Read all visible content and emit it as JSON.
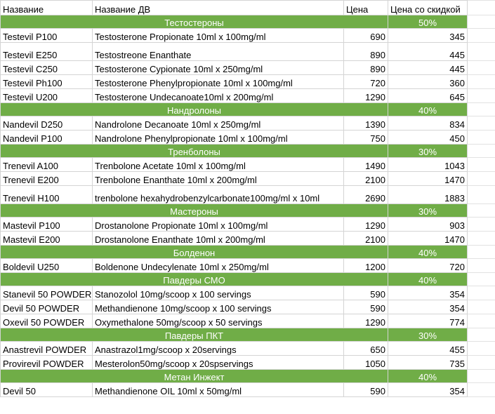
{
  "header": {
    "name": "Название",
    "substance": "Название ДВ",
    "price": "Цена",
    "discount_price": "Цена со скидкой"
  },
  "sections": [
    {
      "title": "Тестостероны",
      "discount": "50%",
      "items": [
        {
          "name": "Testevil P100",
          "substance": "Testosterone Propionate 10ml x 100mg/ml",
          "price": "690",
          "discount_price": "345"
        },
        {
          "name": "Testevil E250",
          "substance": "Testostreone Enanthate",
          "price": "890",
          "discount_price": "445"
        },
        {
          "name": "Testevil C250",
          "substance": "Testosterone Cypionate 10ml x 250mg/ml",
          "price": "890",
          "discount_price": "445"
        },
        {
          "name": "Testevil Ph100",
          "substance": "Testosterone Phenylpropionate 10ml x 100mg/ml",
          "price": "720",
          "discount_price": "360"
        },
        {
          "name": "Testevil U200",
          "substance": "Testosterone Undecanoate10ml x 200mg/ml",
          "price": "1290",
          "discount_price": "645"
        }
      ]
    },
    {
      "title": "Нандролоны",
      "discount": "40%",
      "items": [
        {
          "name": "Nandevil D250",
          "substance": "Nandrolone Decanoate 10ml x 250mg/ml",
          "price": "1390",
          "discount_price": "834"
        },
        {
          "name": "Nandevil P100",
          "substance": "Nandrolone Phenylpropionate 10ml x 100mg/ml",
          "price": "750",
          "discount_price": "450"
        }
      ]
    },
    {
      "title": "Тренболоны",
      "discount": "30%",
      "items": [
        {
          "name": "Trenevil A100",
          "substance": "Trenbolone Acetate 10ml x 100mg/ml",
          "price": "1490",
          "discount_price": "1043"
        },
        {
          "name": "Trenevil E200",
          "substance": "Trenbolone Enanthate 10ml x 200mg/ml",
          "price": "2100",
          "discount_price": "1470"
        },
        {
          "name": "Trenevil H100",
          "substance": "trenbolone hexahydrobenzylcarbonate100mg/ml x 10ml",
          "price": "2690",
          "discount_price": "1883"
        }
      ]
    },
    {
      "title": "Мастероны",
      "discount": "30%",
      "items": [
        {
          "name": "Mastevil P100",
          "substance": "Drostanolone Propionate 10ml x 100mg/ml",
          "price": "1290",
          "discount_price": "903"
        },
        {
          "name": "Mastevil E200",
          "substance": "Drostanolone Enanthate 10ml x 200mg/ml",
          "price": "2100",
          "discount_price": "1470"
        }
      ]
    },
    {
      "title": "Болденон",
      "discount": "40%",
      "items": [
        {
          "name": "Boldevil U250",
          "substance": "Boldenone Undecylenate 10ml x 250mg/ml",
          "price": "1200",
          "discount_price": "720"
        }
      ]
    },
    {
      "title": "Павдеры СМО",
      "discount": "40%",
      "items": [
        {
          "name": "Stanevil 50 POWDER",
          "substance": "Stanozolol 10mg/scoop x 100 servings",
          "price": "590",
          "discount_price": "354"
        },
        {
          "name": "Devil 50 POWDER",
          "substance": "Methandienone  10mg/scoop x 100 servings",
          "price": "590",
          "discount_price": "354"
        },
        {
          "name": "Oxevil 50 POWDER",
          "substance": "Oxymethalone 50mg/scoop x 50 servings",
          "price": "1290",
          "discount_price": "774"
        }
      ]
    },
    {
      "title": "Павдеры ПКТ",
      "discount": "30%",
      "items": [
        {
          "name": "Anastrevil POWDER",
          "substance": "Anastrazol1mg/scoop x 20servings",
          "price": "650",
          "discount_price": "455"
        },
        {
          "name": "Provirevil POWDER",
          "substance": "Mesterolon50mg/scoop x 20spservings",
          "price": "1050",
          "discount_price": "735"
        }
      ]
    },
    {
      "title": "Метан Инжект",
      "discount": "40%",
      "items": [
        {
          "name": "Devil 50",
          "substance": "Methandienone OIL 10ml x 50mg/ml",
          "price": "590",
          "discount_price": "354"
        }
      ]
    }
  ]
}
